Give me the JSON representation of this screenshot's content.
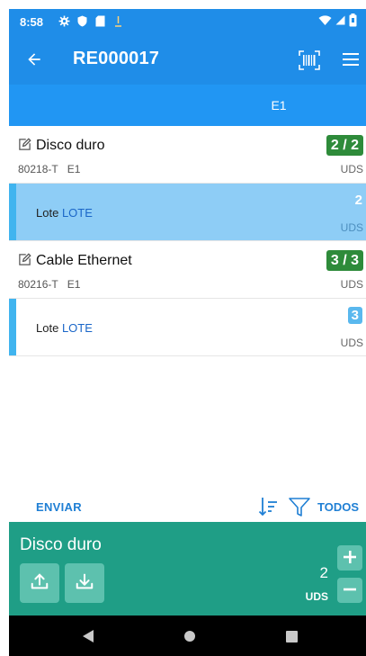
{
  "status_bar": {
    "time": "8:58"
  },
  "app_bar": {
    "title": "RE000017"
  },
  "tabs": [
    {
      "label": "E1"
    }
  ],
  "items": [
    {
      "name": "Disco duro",
      "badge": "2 / 2",
      "code": "80218-T",
      "location": "E1",
      "unit": "UDS",
      "lot": {
        "label": "Lote",
        "value": "LOTE",
        "qty": "2",
        "unit": "UDS"
      }
    },
    {
      "name": "Cable Ethernet",
      "badge": "3 / 3",
      "code": "80216-T",
      "location": "E1",
      "unit": "UDS",
      "lot": {
        "label": "Lote",
        "value": "LOTE",
        "qty": "3",
        "unit": "UDS"
      }
    }
  ],
  "actions": {
    "send_label": "ENVIAR",
    "filter_label": "TODOS"
  },
  "panel": {
    "product_name": "Disco duro",
    "quantity": "2",
    "unit": "UDS"
  },
  "colors": {
    "primary": "#1f8de8",
    "selected_row": "#8ecdf6",
    "badge_green": "#2e8b3a",
    "panel_green": "#1f9e86",
    "link_blue": "#1f7fd4"
  },
  "icons": {
    "back": "arrow-left-icon",
    "barcode": "barcode-scan-icon",
    "menu": "hamburger-menu-icon",
    "edit": "edit-icon",
    "sort": "sort-icon",
    "filter": "filter-icon",
    "upload": "upload-icon",
    "download": "download-icon",
    "plus": "plus-icon",
    "minus": "minus-icon",
    "nav_back": "nav-back-icon",
    "nav_home": "nav-home-icon",
    "nav_recents": "nav-recents-icon"
  }
}
